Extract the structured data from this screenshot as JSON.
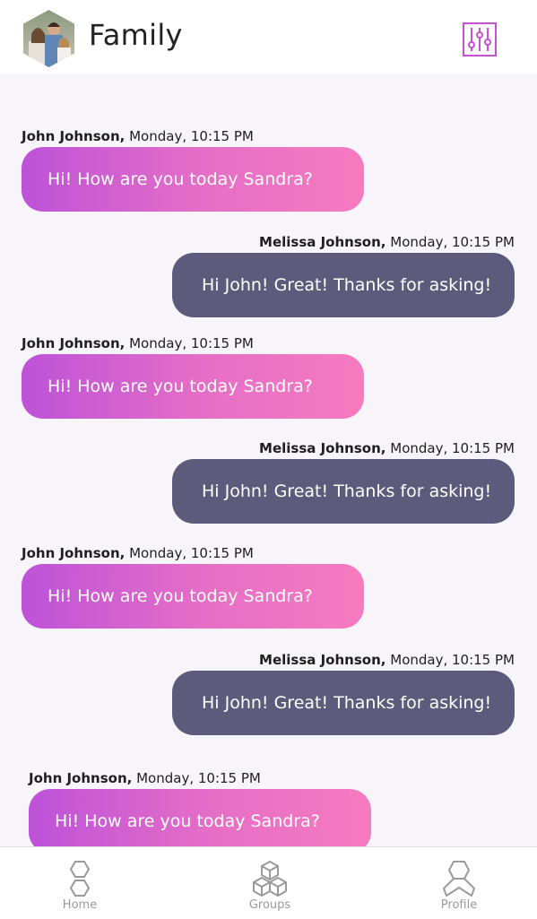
{
  "header": {
    "title": "Family",
    "avatar_alt": "family-photo"
  },
  "messages": [
    {
      "sender": "John Johnson,",
      "time": "Monday, 10:15 PM",
      "text": "Hi! How are you today Sandra?",
      "direction": "incoming"
    },
    {
      "sender": "Melissa Johnson,",
      "time": "Monday, 10:15 PM",
      "text": "Hi John! Great! Thanks for asking!",
      "direction": "outgoing"
    },
    {
      "sender": "John Johnson,",
      "time": "Monday, 10:15 PM",
      "text": "Hi! How are you today Sandra?",
      "direction": "incoming"
    },
    {
      "sender": "Melissa Johnson,",
      "time": "Monday, 10:15 PM",
      "text": "Hi John! Great! Thanks for asking!",
      "direction": "outgoing"
    },
    {
      "sender": "John Johnson,",
      "time": "Monday, 10:15 PM",
      "text": "Hi! How are you today Sandra?",
      "direction": "incoming"
    },
    {
      "sender": "Melissa Johnson,",
      "time": "Monday, 10:15 PM",
      "text": "Hi John! Great! Thanks for asking!",
      "direction": "outgoing"
    },
    {
      "sender": "John Johnson,",
      "time": "Monday, 10:15 PM",
      "text": "Hi! How are you today Sandra?",
      "direction": "incoming"
    }
  ],
  "tabbar": {
    "home": "Home",
    "groups": "Groups",
    "profile": "Profile"
  },
  "colors": {
    "incoming_start": "#bd52d9",
    "incoming_end": "#f77ac0",
    "outgoing": "#5c5b7c",
    "accent": "#c94fd3",
    "background": "#f7f4fa"
  },
  "icons": {
    "settings": "sliders-icon",
    "home": "hexagons-stacked-icon",
    "groups": "cubes-icon",
    "profile": "person-hexagon-icon"
  }
}
